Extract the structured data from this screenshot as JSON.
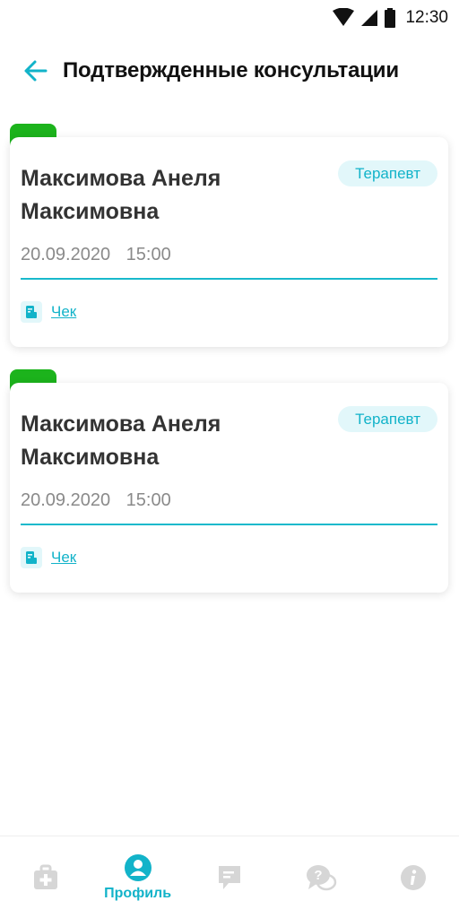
{
  "status_bar": {
    "time": "12:30",
    "icons": [
      "wifi-icon",
      "signal-icon",
      "battery-icon"
    ]
  },
  "header": {
    "back_icon": "arrow-left-icon",
    "title": "Подтвержденные консультации"
  },
  "consultations": [
    {
      "name": "Максимова Анеля Максимовна",
      "specialty": "Терапевт",
      "date": "20.09.2020",
      "time": "15:00",
      "receipt_label": "Чек",
      "status_color": "#1cb31c"
    },
    {
      "name": "Максимова Анеля Максимовна",
      "specialty": "Терапевт",
      "date": "20.09.2020",
      "time": "15:00",
      "receipt_label": "Чек",
      "status_color": "#1cb31c"
    }
  ],
  "bottom_nav": {
    "items": [
      {
        "icon": "medkit-icon",
        "label": "",
        "active": false
      },
      {
        "icon": "profile-icon",
        "label": "Профиль",
        "active": true
      },
      {
        "icon": "chat-icon",
        "label": "",
        "active": false
      },
      {
        "icon": "help-icon",
        "label": "",
        "active": false
      },
      {
        "icon": "info-icon",
        "label": "",
        "active": false
      }
    ]
  },
  "colors": {
    "accent": "#12b3c9",
    "status_green": "#1cb31c",
    "inactive_icon": "#d6d6d6",
    "badge_bg": "#e2f7fa"
  }
}
